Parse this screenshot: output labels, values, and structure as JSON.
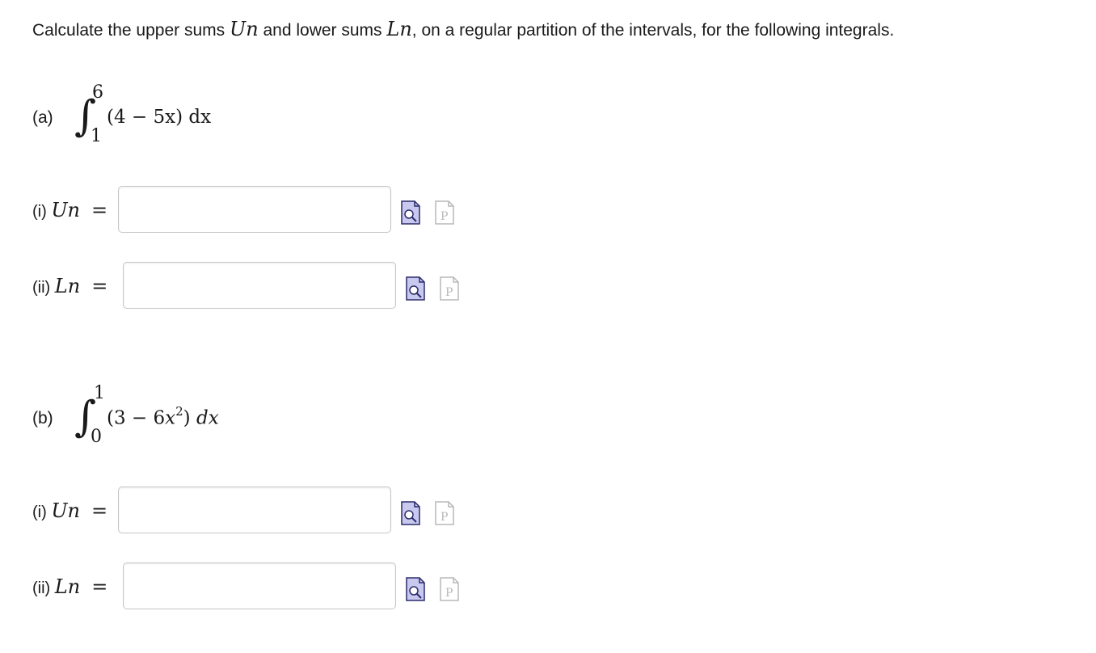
{
  "instructions": {
    "prefix": "Calculate the upper sums ",
    "upper_sym": "Un",
    "middle": " and lower sums ",
    "lower_sym": "Ln",
    "suffix": ", on a regular partition of the intervals, for the following integrals."
  },
  "problems": [
    {
      "label": "(a)",
      "upper_limit": "6",
      "lower_limit": "1",
      "integrand": "(4 − 5x) dx",
      "answers": [
        {
          "label": "(i)",
          "symbol": "Un",
          "eq": "=",
          "value": "",
          "placeholder": ""
        },
        {
          "label": "(ii)",
          "symbol": "Ln",
          "eq": "=",
          "value": "",
          "placeholder": ""
        }
      ]
    },
    {
      "label": "(b)",
      "upper_limit": "1",
      "lower_limit": "0",
      "integrand_parts": {
        "open": "(3 − 6",
        "var": "x",
        "exp": "2",
        "close": ") ",
        "d": "dx"
      },
      "answers": [
        {
          "label": "(i)",
          "symbol": "Un",
          "eq": "=",
          "value": "",
          "placeholder": ""
        },
        {
          "label": "(ii)",
          "symbol": "Ln",
          "eq": "=",
          "value": "",
          "placeholder": ""
        }
      ]
    }
  ],
  "icons": {
    "preview": "preview-icon",
    "palette": "math-palette-icon",
    "preview_fill": "#c9c9f0",
    "preview_stroke": "#2b2b6b",
    "palette_stroke": "#b8b8b8"
  }
}
